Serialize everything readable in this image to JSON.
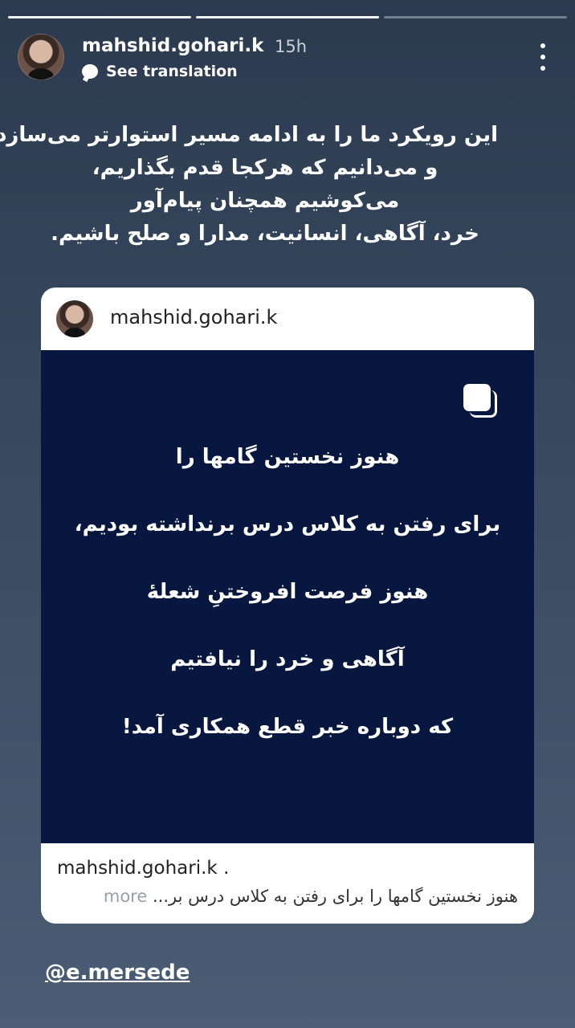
{
  "story": {
    "progress_segments": [
      1,
      1,
      0
    ],
    "username": "mahshid.gohari.k",
    "time": "15h",
    "translate_label": "See translation",
    "caption_lines": [
      "این رویکرد ما را به ادامه مسیر استوارتر می‌سازد",
      "و می‌دانیم که هرکجا قدم بگذاریم،",
      "می‌کوشیم همچنان پیام‌آور",
      "خرد، آگاهی، انسانیت، مدارا و صلح باشیم."
    ],
    "mention": "@e.mersede"
  },
  "card": {
    "username": "mahshid.gohari.k",
    "post_lines": [
      "هنوز نخستین گامها را",
      "برای رفتن به کلاس درس برنداشته بودیم،",
      "هنوز فرصت افروختنِ شعلهٔ",
      "آگاهی و خرد را نیافتیم",
      "که دوباره خبر قطع همکاری آمد!"
    ],
    "footer_user": "mahshid.gohari.k .",
    "footer_text": "هنوز نخستین گامها را برای رفتن به کلاس درس بر...",
    "footer_more": "more"
  },
  "colors": {
    "background_top": "#2b3a4f",
    "background_bottom": "#4a5d74",
    "post_background": "#07173f"
  },
  "icons": [
    "avatar",
    "translate-icon",
    "more-options-icon",
    "multiple-posts-icon"
  ]
}
